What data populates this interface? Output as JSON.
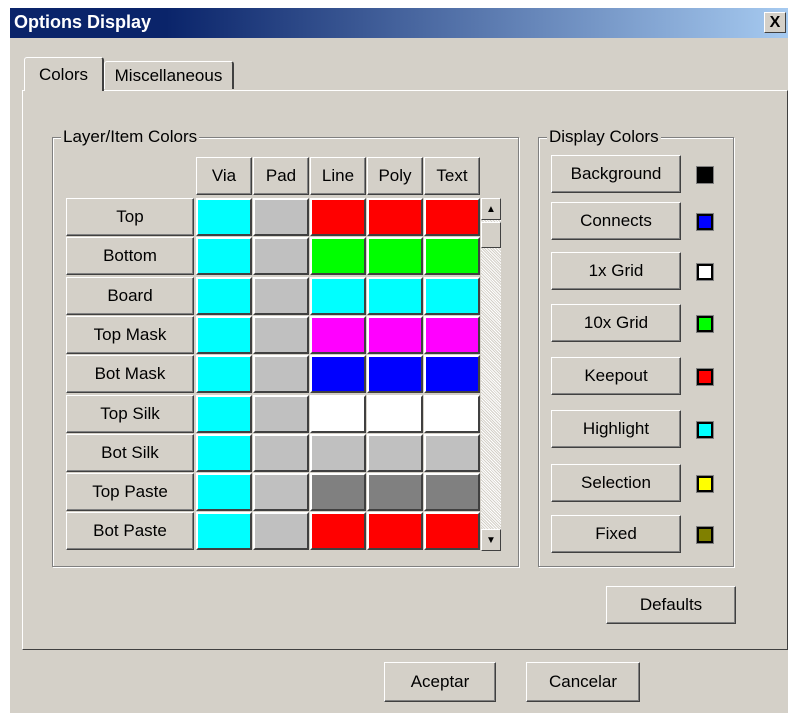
{
  "window": {
    "title": "Options Display",
    "close_label": "X"
  },
  "tabs": [
    {
      "label": "Colors",
      "active": true
    },
    {
      "label": "Miscellaneous",
      "active": false
    }
  ],
  "layer_colors": {
    "group_label": "Layer/Item Colors",
    "columns": [
      "Via",
      "Pad",
      "Line",
      "Poly",
      "Text"
    ],
    "rows": [
      {
        "label": "Top",
        "colors": [
          "#00ffff",
          "#c0c0c0",
          "#ff0000",
          "#ff0000",
          "#ff0000"
        ]
      },
      {
        "label": "Bottom",
        "colors": [
          "#00ffff",
          "#c0c0c0",
          "#00ff00",
          "#00ff00",
          "#00ff00"
        ]
      },
      {
        "label": "Board",
        "colors": [
          "#00ffff",
          "#c0c0c0",
          "#00ffff",
          "#00ffff",
          "#00ffff"
        ]
      },
      {
        "label": "Top Mask",
        "colors": [
          "#00ffff",
          "#c0c0c0",
          "#ff00ff",
          "#ff00ff",
          "#ff00ff"
        ]
      },
      {
        "label": "Bot Mask",
        "colors": [
          "#00ffff",
          "#c0c0c0",
          "#0000ff",
          "#0000ff",
          "#0000ff"
        ]
      },
      {
        "label": "Top Silk",
        "colors": [
          "#00ffff",
          "#c0c0c0",
          "#ffffff",
          "#ffffff",
          "#ffffff"
        ]
      },
      {
        "label": "Bot Silk",
        "colors": [
          "#00ffff",
          "#c0c0c0",
          "#c0c0c0",
          "#c0c0c0",
          "#c0c0c0"
        ]
      },
      {
        "label": "Top Paste",
        "colors": [
          "#00ffff",
          "#c0c0c0",
          "#808080",
          "#808080",
          "#808080"
        ]
      },
      {
        "label": "Bot Paste",
        "colors": [
          "#00ffff",
          "#c0c0c0",
          "#ff0000",
          "#ff0000",
          "#ff0000"
        ]
      }
    ]
  },
  "display_colors": {
    "group_label": "Display Colors",
    "items": [
      {
        "label": "Background",
        "color": "#000000"
      },
      {
        "label": "Connects",
        "color": "#0000ff"
      },
      {
        "label": "1x Grid",
        "color": "#ffffff"
      },
      {
        "label": "10x Grid",
        "color": "#00ff00"
      },
      {
        "label": "Keepout",
        "color": "#ff0000"
      },
      {
        "label": "Highlight",
        "color": "#00ffff"
      },
      {
        "label": "Selection",
        "color": "#ffff00"
      },
      {
        "label": "Fixed",
        "color": "#808000"
      }
    ]
  },
  "buttons": {
    "defaults": "Defaults",
    "accept": "Aceptar",
    "cancel": "Cancelar"
  },
  "scrollbar": {
    "up_icon": "arrow-up-icon",
    "down_icon": "arrow-down-icon"
  }
}
